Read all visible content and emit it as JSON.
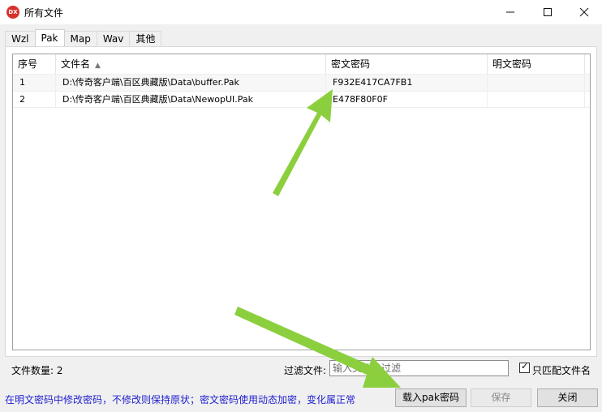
{
  "window": {
    "title": "所有文件",
    "app_icon_text": "DX",
    "minimize_icon": "minimize-icon",
    "maximize_icon": "maximize-icon",
    "close_icon": "close-icon"
  },
  "tabs": [
    {
      "label": "Wzl",
      "active": false
    },
    {
      "label": "Pak",
      "active": true
    },
    {
      "label": "Map",
      "active": false
    },
    {
      "label": "Wav",
      "active": false
    },
    {
      "label": "其他",
      "active": false
    }
  ],
  "table": {
    "headers": {
      "index": "序号",
      "filename": "文件名",
      "cipher": "密文密码",
      "plain": "明文密码"
    },
    "sort_icon": "sort-up-icon",
    "rows": [
      {
        "index": "1",
        "filename": "D:\\传奇客户端\\百区典藏版\\Data\\buffer.Pak",
        "cipher": "F932E417CA7FB1",
        "plain": ""
      },
      {
        "index": "2",
        "filename": "D:\\传奇客户端\\百区典藏版\\Data\\NewopUI.Pak",
        "cipher": "E478F80F0F",
        "plain": ""
      }
    ]
  },
  "footer": {
    "count_label": "文件数量: 2",
    "filter_label": "过滤文件:",
    "filter_placeholder": "输入文件名过滤",
    "match_label": "只匹配文件名",
    "match_checked": true
  },
  "status": {
    "text": "在明文密码中修改密码，不修改则保持原状；密文密码使用动态加密，变化属正常"
  },
  "buttons": {
    "load": "载入pak密码",
    "save": "保存",
    "close": "关闭"
  },
  "colors": {
    "arrow": "#8ccf3e",
    "status_text": "#1f1fd1",
    "app_icon": "#d9302b"
  }
}
